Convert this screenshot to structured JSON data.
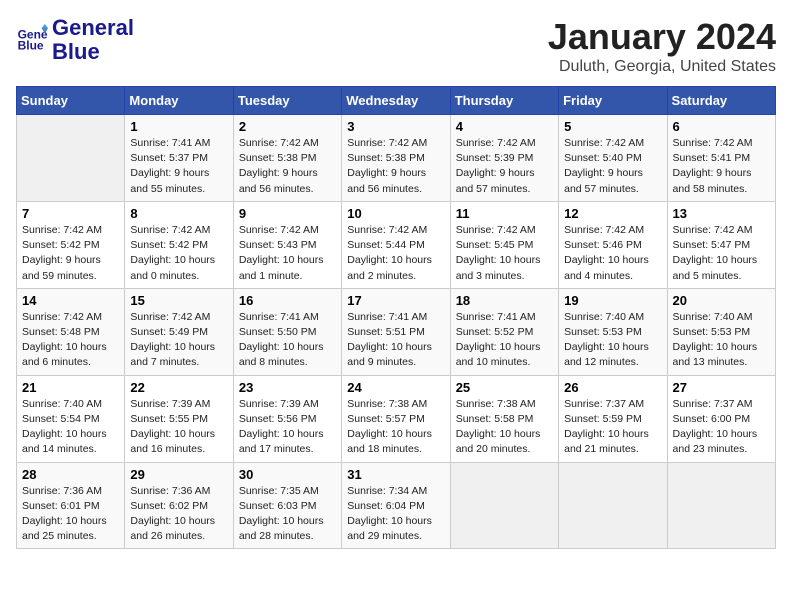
{
  "header": {
    "logo_line1": "General",
    "logo_line2": "Blue",
    "title": "January 2024",
    "subtitle": "Duluth, Georgia, United States"
  },
  "columns": [
    "Sunday",
    "Monday",
    "Tuesday",
    "Wednesday",
    "Thursday",
    "Friday",
    "Saturday"
  ],
  "weeks": [
    [
      {
        "num": "",
        "info": ""
      },
      {
        "num": "1",
        "info": "Sunrise: 7:41 AM\nSunset: 5:37 PM\nDaylight: 9 hours\nand 55 minutes."
      },
      {
        "num": "2",
        "info": "Sunrise: 7:42 AM\nSunset: 5:38 PM\nDaylight: 9 hours\nand 56 minutes."
      },
      {
        "num": "3",
        "info": "Sunrise: 7:42 AM\nSunset: 5:38 PM\nDaylight: 9 hours\nand 56 minutes."
      },
      {
        "num": "4",
        "info": "Sunrise: 7:42 AM\nSunset: 5:39 PM\nDaylight: 9 hours\nand 57 minutes."
      },
      {
        "num": "5",
        "info": "Sunrise: 7:42 AM\nSunset: 5:40 PM\nDaylight: 9 hours\nand 57 minutes."
      },
      {
        "num": "6",
        "info": "Sunrise: 7:42 AM\nSunset: 5:41 PM\nDaylight: 9 hours\nand 58 minutes."
      }
    ],
    [
      {
        "num": "7",
        "info": "Sunrise: 7:42 AM\nSunset: 5:42 PM\nDaylight: 9 hours\nand 59 minutes."
      },
      {
        "num": "8",
        "info": "Sunrise: 7:42 AM\nSunset: 5:42 PM\nDaylight: 10 hours\nand 0 minutes."
      },
      {
        "num": "9",
        "info": "Sunrise: 7:42 AM\nSunset: 5:43 PM\nDaylight: 10 hours\nand 1 minute."
      },
      {
        "num": "10",
        "info": "Sunrise: 7:42 AM\nSunset: 5:44 PM\nDaylight: 10 hours\nand 2 minutes."
      },
      {
        "num": "11",
        "info": "Sunrise: 7:42 AM\nSunset: 5:45 PM\nDaylight: 10 hours\nand 3 minutes."
      },
      {
        "num": "12",
        "info": "Sunrise: 7:42 AM\nSunset: 5:46 PM\nDaylight: 10 hours\nand 4 minutes."
      },
      {
        "num": "13",
        "info": "Sunrise: 7:42 AM\nSunset: 5:47 PM\nDaylight: 10 hours\nand 5 minutes."
      }
    ],
    [
      {
        "num": "14",
        "info": "Sunrise: 7:42 AM\nSunset: 5:48 PM\nDaylight: 10 hours\nand 6 minutes."
      },
      {
        "num": "15",
        "info": "Sunrise: 7:42 AM\nSunset: 5:49 PM\nDaylight: 10 hours\nand 7 minutes."
      },
      {
        "num": "16",
        "info": "Sunrise: 7:41 AM\nSunset: 5:50 PM\nDaylight: 10 hours\nand 8 minutes."
      },
      {
        "num": "17",
        "info": "Sunrise: 7:41 AM\nSunset: 5:51 PM\nDaylight: 10 hours\nand 9 minutes."
      },
      {
        "num": "18",
        "info": "Sunrise: 7:41 AM\nSunset: 5:52 PM\nDaylight: 10 hours\nand 10 minutes."
      },
      {
        "num": "19",
        "info": "Sunrise: 7:40 AM\nSunset: 5:53 PM\nDaylight: 10 hours\nand 12 minutes."
      },
      {
        "num": "20",
        "info": "Sunrise: 7:40 AM\nSunset: 5:53 PM\nDaylight: 10 hours\nand 13 minutes."
      }
    ],
    [
      {
        "num": "21",
        "info": "Sunrise: 7:40 AM\nSunset: 5:54 PM\nDaylight: 10 hours\nand 14 minutes."
      },
      {
        "num": "22",
        "info": "Sunrise: 7:39 AM\nSunset: 5:55 PM\nDaylight: 10 hours\nand 16 minutes."
      },
      {
        "num": "23",
        "info": "Sunrise: 7:39 AM\nSunset: 5:56 PM\nDaylight: 10 hours\nand 17 minutes."
      },
      {
        "num": "24",
        "info": "Sunrise: 7:38 AM\nSunset: 5:57 PM\nDaylight: 10 hours\nand 18 minutes."
      },
      {
        "num": "25",
        "info": "Sunrise: 7:38 AM\nSunset: 5:58 PM\nDaylight: 10 hours\nand 20 minutes."
      },
      {
        "num": "26",
        "info": "Sunrise: 7:37 AM\nSunset: 5:59 PM\nDaylight: 10 hours\nand 21 minutes."
      },
      {
        "num": "27",
        "info": "Sunrise: 7:37 AM\nSunset: 6:00 PM\nDaylight: 10 hours\nand 23 minutes."
      }
    ],
    [
      {
        "num": "28",
        "info": "Sunrise: 7:36 AM\nSunset: 6:01 PM\nDaylight: 10 hours\nand 25 minutes."
      },
      {
        "num": "29",
        "info": "Sunrise: 7:36 AM\nSunset: 6:02 PM\nDaylight: 10 hours\nand 26 minutes."
      },
      {
        "num": "30",
        "info": "Sunrise: 7:35 AM\nSunset: 6:03 PM\nDaylight: 10 hours\nand 28 minutes."
      },
      {
        "num": "31",
        "info": "Sunrise: 7:34 AM\nSunset: 6:04 PM\nDaylight: 10 hours\nand 29 minutes."
      },
      {
        "num": "",
        "info": ""
      },
      {
        "num": "",
        "info": ""
      },
      {
        "num": "",
        "info": ""
      }
    ]
  ]
}
